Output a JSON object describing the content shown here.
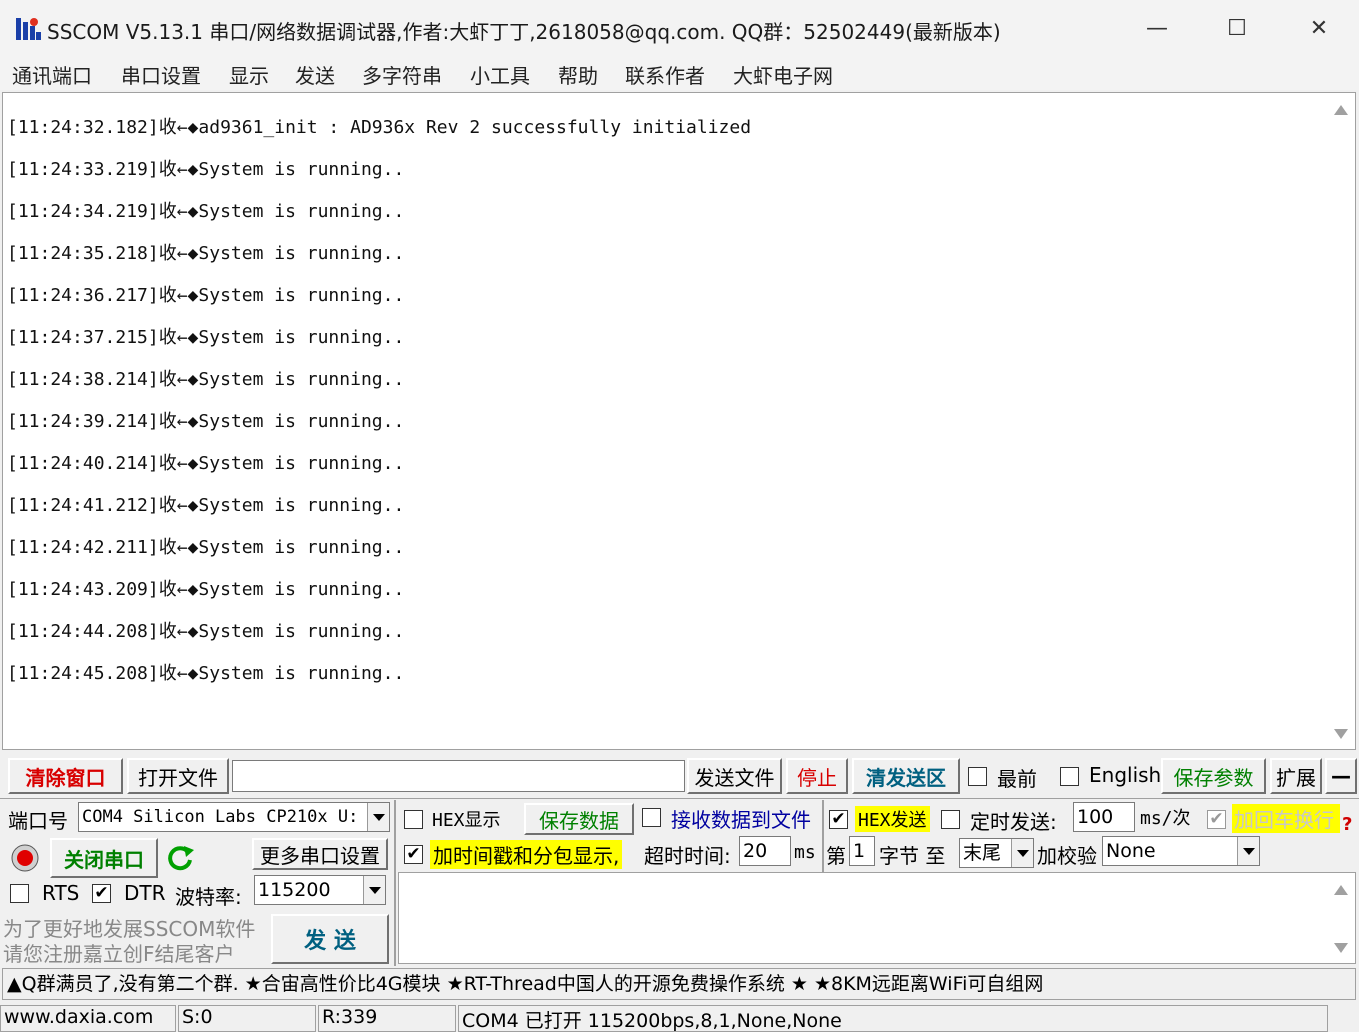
{
  "window": {
    "title": "SSCOM V5.13.1 串口/网络数据调试器,作者:大虾丁丁,2618058@qq.com. QQ群：52502449(最新版本)",
    "min_glyph": "—",
    "max_glyph": "☐",
    "close_glyph": "✕"
  },
  "menu": [
    "通讯端口",
    "串口设置",
    "显示",
    "发送",
    "多字符串",
    "小工具",
    "帮助",
    "联系作者",
    "大虾电子网"
  ],
  "receive_lines": [
    "[11:24:32.182]收←◆ad9361_init : AD936x Rev 2 successfully initialized",
    "[11:24:33.219]收←◆System is running..",
    "[11:24:34.219]收←◆System is running..",
    "[11:24:35.218]收←◆System is running..",
    "[11:24:36.217]收←◆System is running..",
    "[11:24:37.215]收←◆System is running..",
    "[11:24:38.214]收←◆System is running..",
    "[11:24:39.214]收←◆System is running..",
    "[11:24:40.214]收←◆System is running..",
    "[11:24:41.212]收←◆System is running..",
    "[11:24:42.211]收←◆System is running..",
    "[11:24:43.209]收←◆System is running..",
    "[11:24:44.208]收←◆System is running..",
    "[11:24:45.208]收←◆System is running.."
  ],
  "toolbar": {
    "clear_window": "清除窗口",
    "open_file": "打开文件",
    "file_path": "",
    "send_file": "发送文件",
    "stop": "停止",
    "clear_send": "清发送区",
    "topmost": "最前",
    "topmost_checked": false,
    "english": "English",
    "english_checked": false,
    "save_params": "保存参数",
    "expand": "扩展",
    "collapse": "—"
  },
  "port": {
    "label": "端口号",
    "value": "COM4 Silicon Labs CP210x U:",
    "close_port": "关闭串口",
    "more_settings": "更多串口设置",
    "rts": "RTS",
    "rts_checked": false,
    "dtr": "DTR",
    "dtr_checked": true,
    "baud_label": "波特率:",
    "baud_value": "115200",
    "promo_line1": "为了更好地发展SSCOM软件",
    "promo_line2": "请您注册嘉立创F结尾客户",
    "send_button": "发  送"
  },
  "options": {
    "hex_display": "HEX显示",
    "hex_display_checked": false,
    "save_data": "保存数据",
    "recv_to_file": "接收数据到文件",
    "recv_to_file_checked": false,
    "hex_send": "HEX发送",
    "hex_send_checked": true,
    "timed_send": "定时发送:",
    "timed_send_checked": false,
    "interval_value": "100",
    "interval_unit": "ms/次",
    "append_crlf": "加回车换行",
    "append_crlf_checked": true,
    "timestamp": "加时间戳和分包显示,",
    "timestamp_checked": true,
    "timeout_label": "超时时间:",
    "timeout_value": "20",
    "timeout_unit": "ms",
    "nth_label": "第",
    "nth_value": "1",
    "byte_to": "字节 至",
    "end_value": "末尾",
    "checksum_label": "加校验",
    "checksum_value": "None"
  },
  "ticker": "▲Q群满员了,没有第二个群. ★合宙高性价比4G模块 ★RT-Thread中国人的开源免费操作系统 ★ ★8KM远距离WiFi可自组网",
  "status": {
    "website": "www.daxia.com",
    "sent": "S:0",
    "received": "R:339",
    "port_state": "COM4 已打开  115200bps,8,1,None,None"
  },
  "colors": {
    "accent_red": "#d80000",
    "accent_green": "#008000",
    "highlight_yellow": "#ffff00"
  }
}
